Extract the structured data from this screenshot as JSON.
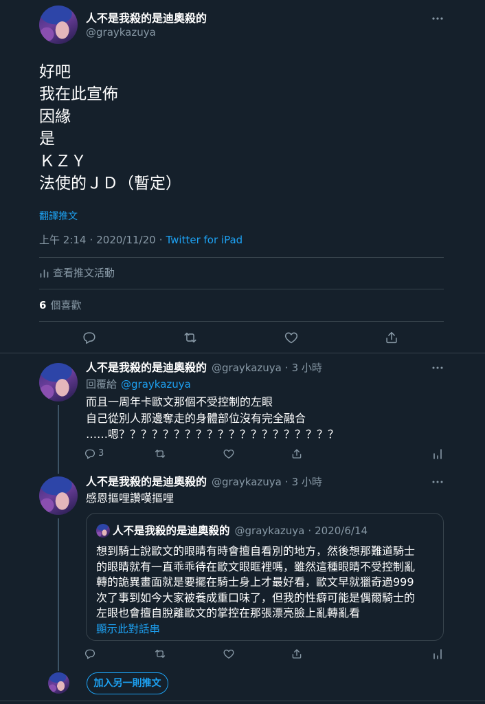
{
  "theme": {
    "background": "#15202B",
    "text": "#FFFFFF",
    "secondary": "#8899A6",
    "accent": "#1DA1F2",
    "border": "#38444D",
    "thread_line": "#3D5466"
  },
  "icons": {
    "more": "more-icon",
    "reply": "reply-icon",
    "retweet": "retweet-icon",
    "like": "heart-icon",
    "share": "share-icon",
    "analytics": "analytics-icon",
    "activity": "activity-icon"
  },
  "main_tweet": {
    "author": {
      "name": "人不是我殺的是迪奧殺的",
      "handle": "@graykazuya"
    },
    "text_lines": [
      "好吧",
      "我在此宣佈",
      "因緣",
      "是",
      "ＫＺＹ",
      "法使的ＪＤ（暫定）"
    ],
    "translate_label": "翻譯推文",
    "meta": {
      "time": "上午 2:14",
      "separator": "·",
      "date": "2020/11/20",
      "source": "Twitter for iPad"
    },
    "activity_label": "查看推文活動",
    "likes": {
      "count": "6",
      "label": "個喜歡"
    }
  },
  "replies": [
    {
      "author": {
        "name": "人不是我殺的是迪奧殺的",
        "handle": "@graykazuya"
      },
      "separator": "·",
      "time": "3 小時",
      "reply_to": {
        "label": "回覆給",
        "handle": "@graykazuya"
      },
      "text_lines": [
        "而且一周年卡歐文那個不受控制的左眼",
        "自己從別人那邊奪走的身體部位沒有完全融合",
        "……嗯？？？？？？？？？？？？？？？？？？？？"
      ],
      "reply_count": "3"
    },
    {
      "author": {
        "name": "人不是我殺的是迪奧殺的",
        "handle": "@graykazuya"
      },
      "separator": "·",
      "time": "3 小時",
      "text_lines": [
        "感恩摳哩讚嘆摳哩"
      ],
      "quote": {
        "author": {
          "name": "人不是我殺的是迪奧殺的",
          "handle": "@graykazuya"
        },
        "separator": "·",
        "date": "2020/6/14",
        "text_lines": [
          "想到騎士說歐文的眼睛有時會擅自看別的地方，然後想那難道騎士",
          "的眼睛就有一直乖乖待在歐文眼眶裡嗎，雖然這種眼睛不受控制亂",
          "轉的詭異畫面就是要擺在騎士身上才最好看，歐文早就獵奇過999",
          "次了事到如今大家被養成重口味了，但我的性癖可能是偶爾騎士的",
          "左眼也會擅自脫離歐文的掌控在那張漂亮臉上亂轉亂看"
        ],
        "show_thread_label": "顯示此對話串"
      }
    }
  ],
  "composer": {
    "add_tweet_label": "加入另一則推文"
  }
}
